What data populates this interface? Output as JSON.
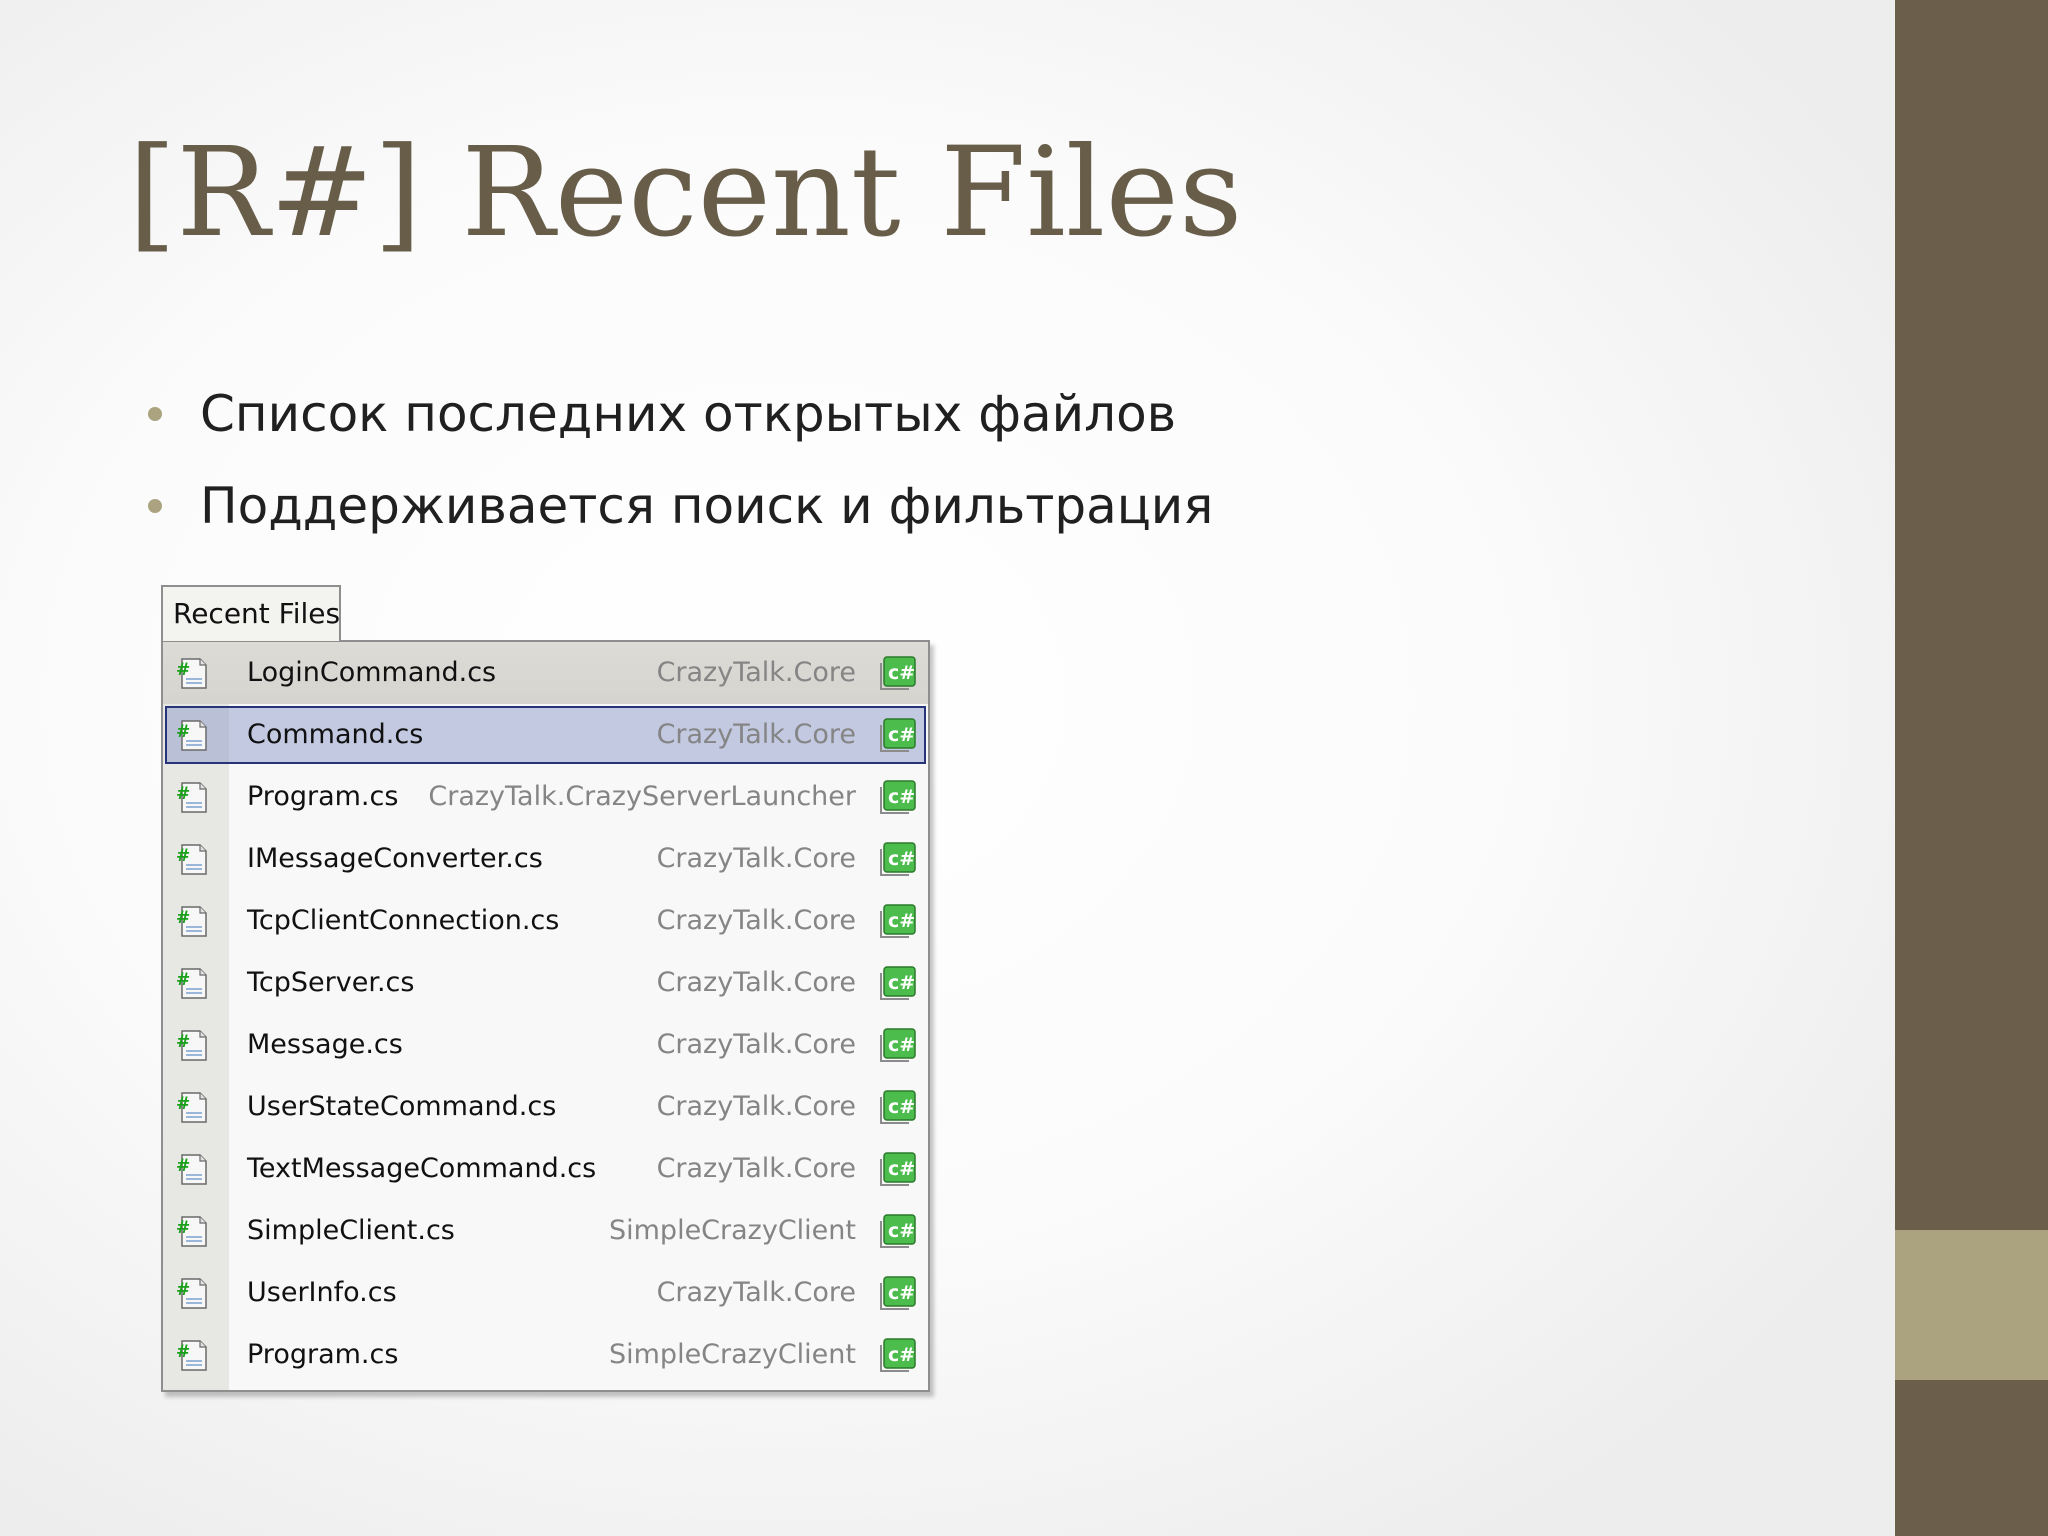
{
  "slide": {
    "title": "[R#] Recent Files",
    "bullets": [
      "Список последних открытых файлов",
      "Поддерживается поиск и фильтрация"
    ]
  },
  "popup": {
    "tab_label": "Recent Files",
    "files": [
      {
        "name": "LoginCommand.cs",
        "project": "CrazyTalk.Core",
        "file_icon": "csharp-file-icon",
        "lang_icon": "csharp-project-icon",
        "state": "hover"
      },
      {
        "name": "Command.cs",
        "project": "CrazyTalk.Core",
        "file_icon": "csharp-file-icon",
        "lang_icon": "csharp-project-icon",
        "state": "selected"
      },
      {
        "name": "Program.cs",
        "project": "CrazyTalk.CrazyServerLauncher",
        "file_icon": "csharp-file-icon",
        "lang_icon": "csharp-project-icon",
        "state": "normal"
      },
      {
        "name": "IMessageConverter.cs",
        "project": "CrazyTalk.Core",
        "file_icon": "csharp-file-icon",
        "lang_icon": "csharp-project-icon",
        "state": "normal"
      },
      {
        "name": "TcpClientConnection.cs",
        "project": "CrazyTalk.Core",
        "file_icon": "csharp-file-icon",
        "lang_icon": "csharp-project-icon",
        "state": "normal"
      },
      {
        "name": "TcpServer.cs",
        "project": "CrazyTalk.Core",
        "file_icon": "csharp-file-icon",
        "lang_icon": "csharp-project-icon",
        "state": "normal"
      },
      {
        "name": "Message.cs",
        "project": "CrazyTalk.Core",
        "file_icon": "csharp-file-icon",
        "lang_icon": "csharp-project-icon",
        "state": "normal"
      },
      {
        "name": "UserStateCommand.cs",
        "project": "CrazyTalk.Core",
        "file_icon": "csharp-file-icon",
        "lang_icon": "csharp-project-icon",
        "state": "normal"
      },
      {
        "name": "TextMessageCommand.cs",
        "project": "CrazyTalk.Core",
        "file_icon": "csharp-file-icon",
        "lang_icon": "csharp-project-icon",
        "state": "normal"
      },
      {
        "name": "SimpleClient.cs",
        "project": "SimpleCrazyClient",
        "file_icon": "csharp-file-icon",
        "lang_icon": "csharp-project-icon",
        "state": "normal"
      },
      {
        "name": "UserInfo.cs",
        "project": "CrazyTalk.Core",
        "file_icon": "csharp-file-icon",
        "lang_icon": "csharp-project-icon",
        "state": "normal"
      },
      {
        "name": "Program.cs",
        "project": "SimpleCrazyClient",
        "file_icon": "csharp-file-icon",
        "lang_icon": "csharp-project-icon",
        "state": "normal"
      }
    ]
  },
  "colors": {
    "title": "#675d49",
    "side_bar": "#6b5f4b",
    "side_accent": "#aba37f",
    "bullet_dot": "#aba37f",
    "selection_border": "#26357a",
    "selection_fill": "#aab4d8",
    "hover_fill": "#d9d7d2",
    "project_text": "#858585",
    "csharp_green": "#19a019"
  }
}
